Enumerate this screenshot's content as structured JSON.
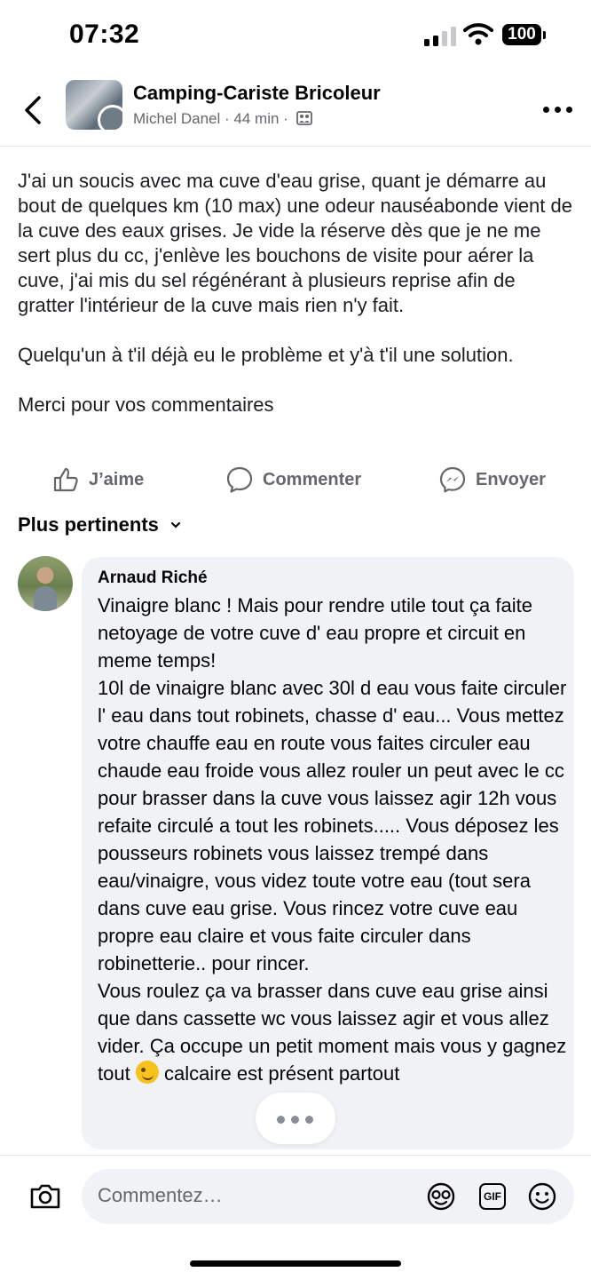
{
  "status": {
    "time": "07:32",
    "battery": "100"
  },
  "header": {
    "group_name": "Camping-Cariste Bricoleur",
    "author": "Michel Danel",
    "separator": "·",
    "time_ago": "44 min"
  },
  "post": {
    "paragraphs": [
      "J'ai un soucis avec ma cuve d'eau grise, quant je démarre au bout de quelques km (10 max) une odeur nauséabonde vient de la cuve des eaux grises. Je vide la réserve dès que je ne me sert plus du cc, j'enlève les bouchons de visite pour aérer la cuve, j'ai mis du sel régénérant à plusieurs reprise afin de gratter l'intérieur de la cuve mais rien n'y fait.",
      "Quelqu'un à t'il déjà eu le problème et y'à t'il une solution.",
      "Merci pour vos commentaires"
    ]
  },
  "actions": {
    "like": "J’aime",
    "comment": "Commenter",
    "send": "Envoyer"
  },
  "comments_sort": {
    "label": "Plus pertinents"
  },
  "comment": {
    "author": "Arnaud Riché",
    "line1": "Vinaigre blanc ! Mais pour rendre utile tout ça faite netoyage de votre cuve d' eau propre et circuit en meme temps!",
    "line2": "10l de vinaigre blanc avec 30l d eau vous faite circuler l' eau dans tout robinets, chasse d' eau... Vous mettez votre chauffe eau en route vous faites circuler eau chaude eau froide vous allez rouler un peut avec le cc pour brasser dans la cuve vous laissez agir 12h vous refaite circulé a tout les robinets..... Vous déposez les pousseurs robinets vous laissez trempé dans eau/vinaigre, vous videz toute votre eau (tout sera dans cuve eau grise. Vous rincez votre cuve eau propre eau claire et vous faite circuler dans robinetterie.. pour rincer.",
    "line3_a": "Vous roulez ça va brasser dans cuve eau grise ainsi que dans cassette wc vous laissez agir et vous allez vider. Ça occupe un petit moment mais vous y gagnez",
    "line3_b": "tout",
    "line3_c": "calcaire est présent partout",
    "emoji": "winking-face"
  },
  "composer": {
    "placeholder": "Commentez…",
    "gif_label": "GIF"
  },
  "colors": {
    "secondary_text": "#65676b",
    "bubble": "#f0f2f5",
    "divider": "#e4e6eb"
  }
}
